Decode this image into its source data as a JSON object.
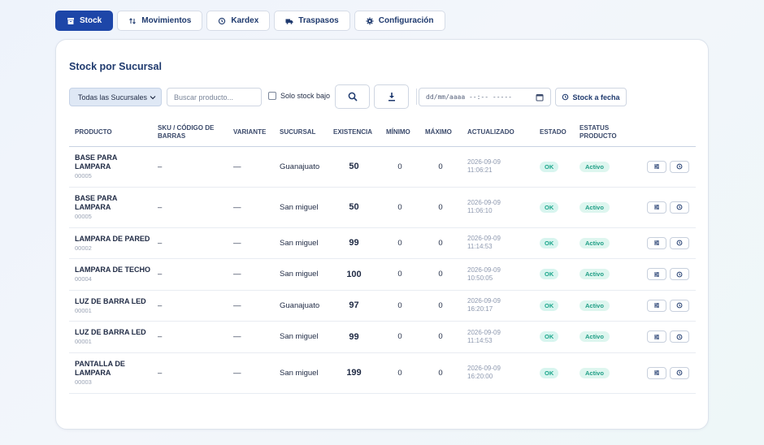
{
  "tabs": [
    {
      "label": "Stock",
      "icon": "box-icon",
      "active": true
    },
    {
      "label": "Movimientos",
      "icon": "arrows-icon",
      "active": false
    },
    {
      "label": "Kardex",
      "icon": "history-icon",
      "active": false
    },
    {
      "label": "Traspasos",
      "icon": "truck-icon",
      "active": false
    },
    {
      "label": "Configuración",
      "icon": "gear-icon",
      "active": false
    }
  ],
  "card": {
    "title": "Stock por Sucursal"
  },
  "toolbar": {
    "branch_select": "Todas las Sucursales",
    "search_placeholder": "Buscar producto...",
    "low_stock_label": "Solo stock bajo",
    "date_placeholder": "dd/mm/aaaa --:-- -----",
    "stock_date_label": "Stock a fecha"
  },
  "table": {
    "headers": [
      "Producto",
      "SKU / Código de barras",
      "Variante",
      "Sucursal",
      "Existencia",
      "Mínimo",
      "Máximo",
      "Actualizado",
      "Estado",
      "Estatus producto"
    ],
    "rows": [
      {
        "name": "BASE PARA LAMPARA",
        "code": "00005",
        "sku": "–",
        "variant": "—",
        "branch": "Guanajuato",
        "stock": "50",
        "min": "0",
        "max": "0",
        "date": "2026-09-09",
        "time": "11:06:21",
        "state": "OK",
        "status": "Activo"
      },
      {
        "name": "BASE PARA LAMPARA",
        "code": "00005",
        "sku": "–",
        "variant": "—",
        "branch": "San miguel",
        "stock": "50",
        "min": "0",
        "max": "0",
        "date": "2026-09-09",
        "time": "11:06:10",
        "state": "OK",
        "status": "Activo"
      },
      {
        "name": "LAMPARA DE PARED",
        "code": "00002",
        "sku": "–",
        "variant": "—",
        "branch": "San miguel",
        "stock": "99",
        "min": "0",
        "max": "0",
        "date": "2026-09-09",
        "time": "11:14:53",
        "state": "OK",
        "status": "Activo"
      },
      {
        "name": "LAMPARA DE TECHO",
        "code": "00004",
        "sku": "–",
        "variant": "—",
        "branch": "San miguel",
        "stock": "100",
        "min": "0",
        "max": "0",
        "date": "2026-09-09",
        "time": "10:50:05",
        "state": "OK",
        "status": "Activo"
      },
      {
        "name": "LUZ DE BARRA LED",
        "code": "00001",
        "sku": "–",
        "variant": "—",
        "branch": "Guanajuato",
        "stock": "97",
        "min": "0",
        "max": "0",
        "date": "2026-09-09",
        "time": "16:20:17",
        "state": "OK",
        "status": "Activo"
      },
      {
        "name": "LUZ DE BARRA LED",
        "code": "00001",
        "sku": "–",
        "variant": "—",
        "branch": "San miguel",
        "stock": "99",
        "min": "0",
        "max": "0",
        "date": "2026-09-09",
        "time": "11:14:53",
        "state": "OK",
        "status": "Activo"
      },
      {
        "name": "PANTALLA DE LAMPARA",
        "code": "00003",
        "sku": "–",
        "variant": "—",
        "branch": "San miguel",
        "stock": "199",
        "min": "0",
        "max": "0",
        "date": "2026-09-09",
        "time": "16:20:00",
        "state": "OK",
        "status": "Activo"
      }
    ]
  },
  "colors": {
    "accent": "#1d46a8",
    "ok_bg": "#d8f5ef",
    "ok_text": "#1aa58a"
  }
}
